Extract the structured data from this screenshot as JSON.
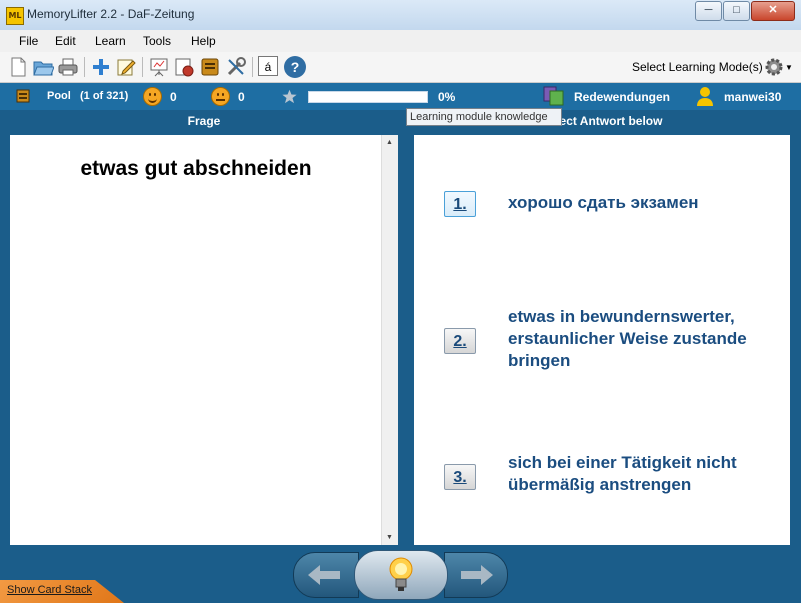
{
  "window": {
    "app_icon_text": "ML",
    "title": "MemoryLifter 2.2 - DaF-Zeitung",
    "minimize": "─",
    "maximize": "□",
    "close": "✕"
  },
  "menu": {
    "items": [
      "File",
      "Edit",
      "Learn",
      "Tools",
      "Help"
    ]
  },
  "toolbar": {
    "icons": [
      "new-document-icon",
      "open-folder-icon",
      "print-icon",
      "add-card-icon",
      "edit-card-icon",
      "presentation-icon",
      "statistics-icon",
      "book-icon",
      "tools-icon",
      "special-char-icon",
      "help-icon"
    ],
    "special_char_label": "á",
    "help_label": "?",
    "modes_label": "Select Learning Mode(s)"
  },
  "status": {
    "pool_label": "Pool",
    "pool_count": "(1 of 321)",
    "happy_count": "0",
    "sad_count": "0",
    "progress_percent": 0,
    "progress_text": "0%",
    "chapter": "Redewendungen",
    "user": "manwei30",
    "tooltip": "Learning module knowledge"
  },
  "question": {
    "header": "Frage",
    "text": "etwas gut abschneiden"
  },
  "answers": {
    "header": "Select Antwort below",
    "options": [
      {
        "key": "1.",
        "text": "хорошо сдать экзамен"
      },
      {
        "key": "2.",
        "text": "etwas in bewundernswerter, erstaunlicher Weise zustande bringen"
      },
      {
        "key": "3.",
        "text": "sich bei einer Tätigkeit nicht übermäßig anstrengen"
      }
    ]
  },
  "bottom": {
    "show_card_stack": "Show Card Stack"
  },
  "colors": {
    "background": "#1b5d8a",
    "status_bar": "#1e6ea3",
    "answer_text": "#1b4d80",
    "progress_fill": "#5fb14d"
  }
}
